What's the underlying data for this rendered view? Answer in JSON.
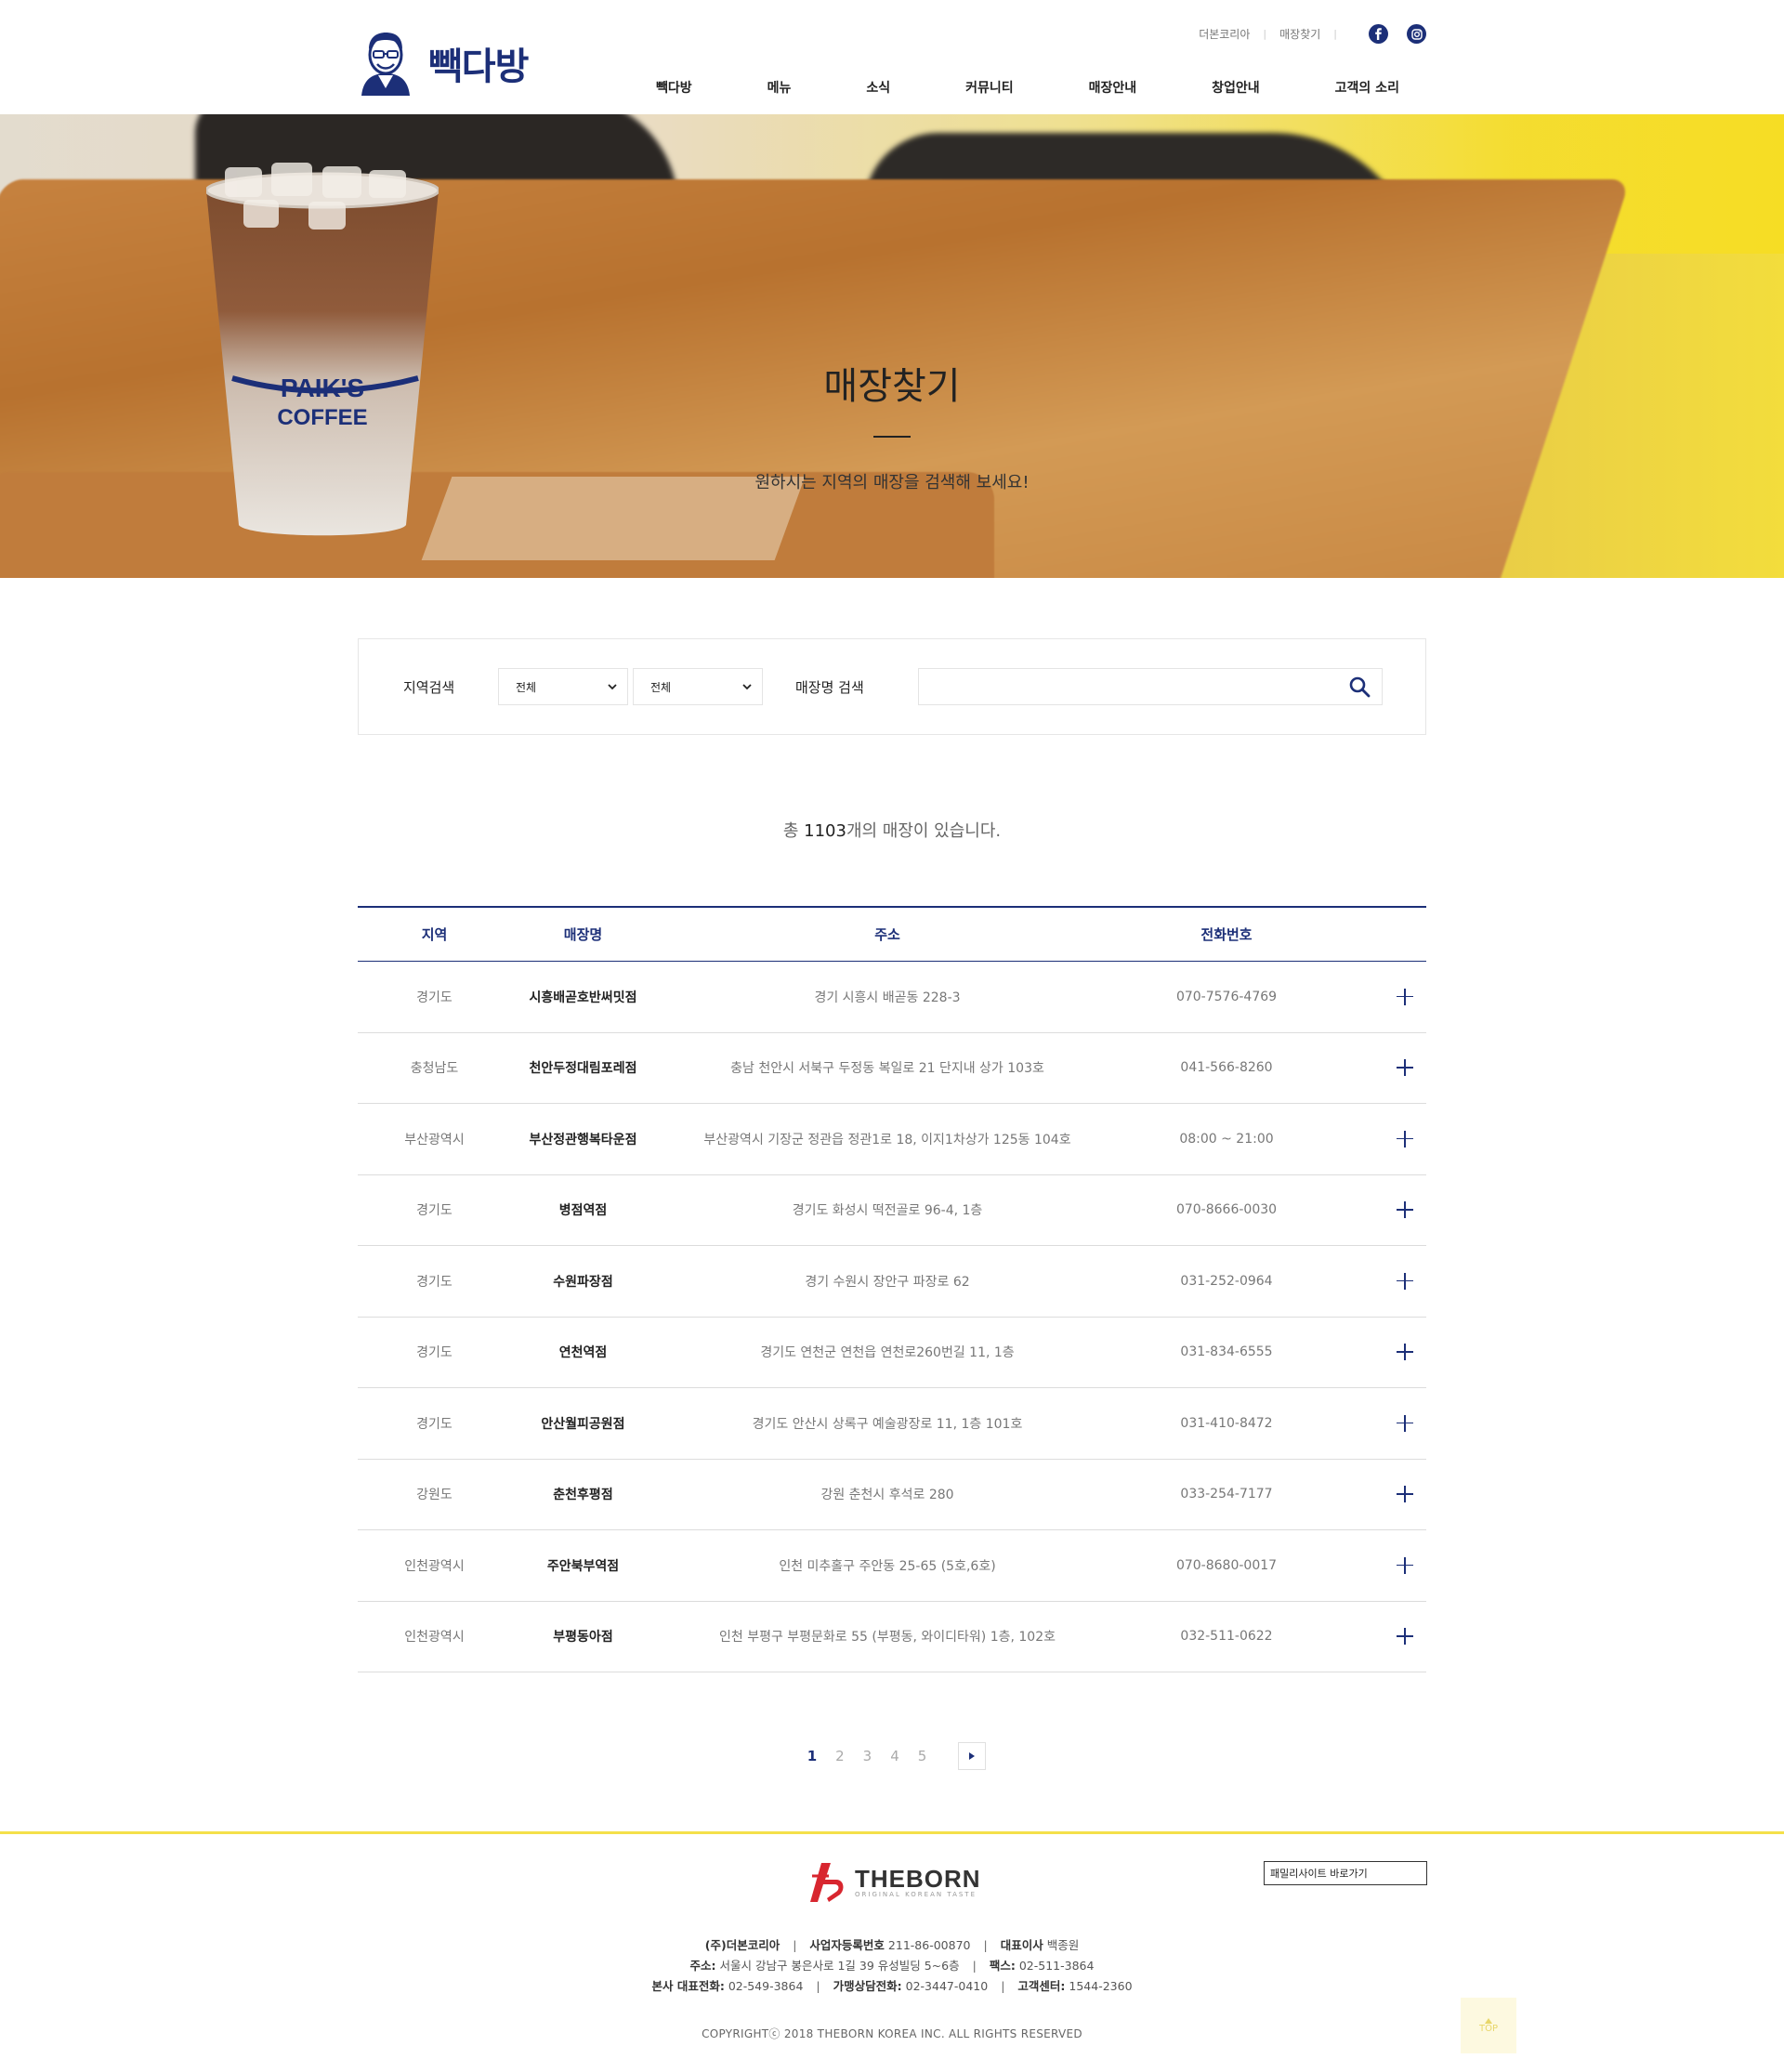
{
  "brand": {
    "name": "빽다방"
  },
  "util_links": [
    "더본코리아",
    "매장찾기"
  ],
  "social": [
    {
      "icon": "facebook-icon",
      "color": "#1c2f78"
    },
    {
      "icon": "instagram-icon",
      "color": "#1c2f78"
    }
  ],
  "gnb": [
    "빽다방",
    "메뉴",
    "소식",
    "커뮤니티",
    "매장안내",
    "창업안내",
    "고객의 소리"
  ],
  "hero": {
    "title": "매장찾기",
    "subtitle": "원하시는 지역의 매장을 검색해 보세요!",
    "cup_text_1": "PAIK'S",
    "cup_text_2": "COFFEE"
  },
  "search": {
    "region_label": "지역검색",
    "region1_value": "전체",
    "region2_value": "전체",
    "name_label": "매장명 검색",
    "name_placeholder": "",
    "name_value": ""
  },
  "count": {
    "prefix": "총 ",
    "number": "1103",
    "suffix": "개의 매장이 있습니다."
  },
  "table": {
    "headers": {
      "region": "지역",
      "name": "매장명",
      "address": "주소",
      "phone": "전화번호"
    },
    "rows": [
      {
        "region": "경기도",
        "name": "시흥배곧호반써밋점",
        "address": "경기 시흥시 배곧동 228-3",
        "phone": "070-7576-4769"
      },
      {
        "region": "충청남도",
        "name": "천안두정대림포레점",
        "address": "충남 천안시 서북구 두정동 복일로 21 단지내 상가 103호",
        "phone": "041-566-8260"
      },
      {
        "region": "부산광역시",
        "name": "부산정관행복타운점",
        "address": "부산광역시 기장군 정관읍 정관1로 18, 이지1차상가 125동 104호",
        "phone": "08:00 ~ 21:00"
      },
      {
        "region": "경기도",
        "name": "병점역점",
        "address": "경기도 화성시 떡전골로 96-4, 1층",
        "phone": "070-8666-0030"
      },
      {
        "region": "경기도",
        "name": "수원파장점",
        "address": "경기 수원시 장안구 파장로 62",
        "phone": "031-252-0964"
      },
      {
        "region": "경기도",
        "name": "연천역점",
        "address": "경기도 연천군 연천읍 연천로260번길 11, 1층",
        "phone": "031-834-6555"
      },
      {
        "region": "경기도",
        "name": "안산월피공원점",
        "address": "경기도 안산시 상록구 예술광장로 11, 1층 101호",
        "phone": "031-410-8472"
      },
      {
        "region": "강원도",
        "name": "춘천후평점",
        "address": "강원 춘천시 후석로 280",
        "phone": "033-254-7177"
      },
      {
        "region": "인천광역시",
        "name": "주안북부역점",
        "address": "인천 미추홀구 주안동 25-65 (5호,6호)",
        "phone": "070-8680-0017"
      },
      {
        "region": "인천광역시",
        "name": "부평동아점",
        "address": "인천 부평구 부평문화로 55 (부평동, 와이디타워) 1층, 102호",
        "phone": "032-511-0622"
      }
    ]
  },
  "pagination": {
    "pages": [
      "1",
      "2",
      "3",
      "4",
      "5"
    ],
    "current": "1",
    "next_icon": "next-arrow-icon"
  },
  "footer": {
    "logo_text": "THEBORN",
    "logo_tag": "ORIGINAL KOREAN TASTE",
    "family_label": "패밀리사이트 바로가기",
    "company": "(주)더본코리아",
    "biz_label": "사업자등록번호",
    "biz_value": "211-86-00870",
    "ceo_label": "대표이사",
    "ceo_value": "백종원",
    "addr_label": "주소:",
    "addr_value": "서울시 강남구 봉은사로 1길 39 유성빌딩 5~6층",
    "fax_label": "팩스:",
    "fax_value": "02-511-3864",
    "hq_label": "본사 대표전화:",
    "hq_value": "02-549-3864",
    "franchise_label": "가맹상담전화:",
    "franchise_value": "02-3447-0410",
    "cs_label": "고객센터:",
    "cs_value": "1544-2360",
    "copyright": "COPYRIGHTⓒ 2018 THEBORN KOREA INC. ALL RIGHTS RESERVED",
    "top_label": "TOP"
  },
  "colors": {
    "brand_navy": "#1c2f78",
    "footer_yellow": "#f4e04a",
    "theborn_red": "#d8262f"
  }
}
